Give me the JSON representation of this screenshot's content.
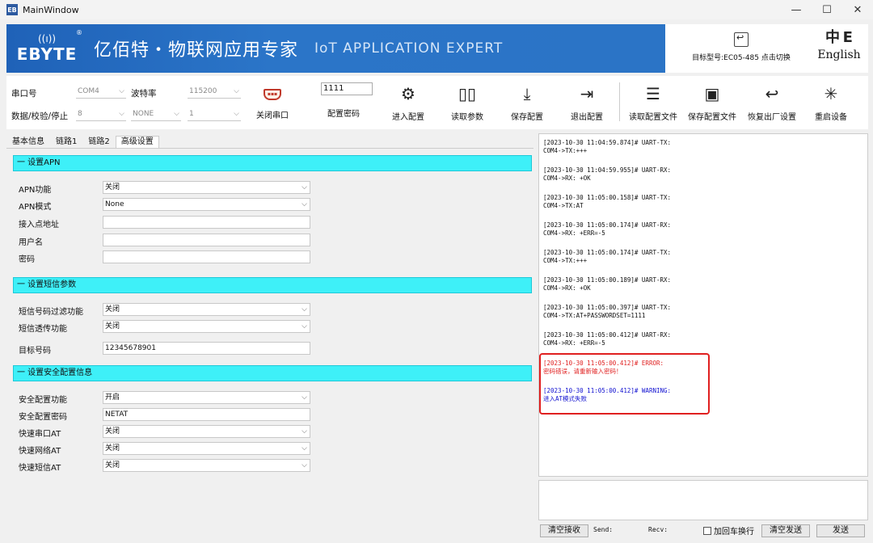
{
  "window": {
    "title": "MainWindow",
    "icon_text": "EB",
    "minimize": "—",
    "maximize": "☐",
    "close": "✕"
  },
  "banner": {
    "logo_signal": "((ı))",
    "logo_text": "EBYTE",
    "logo_reg": "®",
    "title_cn": "亿佰特・物联网应用专家",
    "title_en": "IoT APPLICATION EXPERT",
    "target_model": "目标型号:EC05-485 点击切换",
    "lang_icon": "中 E",
    "lang_label": "English"
  },
  "toolbar": {
    "port_label": "串口号",
    "port_value": "COM4",
    "baud_label": "波特率",
    "baud_value": "115200",
    "dataformat_label": "数据/校验/停止",
    "databits_value": "8",
    "parity_value": "NONE",
    "stopbits_value": "1",
    "close_port_label": "关闭串口",
    "serial_icon_text": "▪▪▪",
    "password_value": "1111",
    "password_label": "配置密码",
    "tools": [
      {
        "icon": "⚙",
        "label": "进入配置"
      },
      {
        "icon": "▯▯",
        "label": "读取参数"
      },
      {
        "icon": "⤓",
        "label": "保存配置"
      },
      {
        "icon": "⇥",
        "label": "退出配置"
      },
      {
        "icon": "☰",
        "label": "读取配置文件"
      },
      {
        "icon": "▣",
        "label": "保存配置文件"
      },
      {
        "icon": "↩",
        "label": "恢复出厂设置"
      },
      {
        "icon": "✳",
        "label": "重启设备"
      }
    ]
  },
  "tabs": [
    "基本信息",
    "链路1",
    "链路2",
    "高级设置"
  ],
  "sections": [
    {
      "title": "一 设置APN",
      "rows": [
        {
          "label": "APN功能",
          "value": "关闭",
          "dropdown": true
        },
        {
          "label": "APN模式",
          "value": "None",
          "dropdown": true
        },
        {
          "label": "接入点地址",
          "value": "",
          "dropdown": false
        },
        {
          "label": "用户名",
          "value": "",
          "dropdown": false
        },
        {
          "label": "密码",
          "value": "",
          "dropdown": false
        }
      ]
    },
    {
      "title": "一 设置短信参数",
      "rows": [
        {
          "label": "短信号码过滤功能",
          "value": "关闭",
          "dropdown": true
        },
        {
          "label": "短信透传功能",
          "value": "关闭",
          "dropdown": true
        },
        {
          "label": "目标号码",
          "value": "12345678901",
          "dropdown": false
        }
      ]
    },
    {
      "title": "一 设置安全配置信息",
      "rows": [
        {
          "label": "安全配置功能",
          "value": "开启",
          "dropdown": true
        },
        {
          "label": "安全配置密码",
          "value": "NETAT",
          "dropdown": false
        },
        {
          "label": "快速串口AT",
          "value": "关闭",
          "dropdown": true
        },
        {
          "label": "快速网络AT",
          "value": "关闭",
          "dropdown": true
        },
        {
          "label": "快速短信AT",
          "value": "关闭",
          "dropdown": true
        }
      ]
    }
  ],
  "log": [
    {
      "line1": "[2023-10-30 11:04:59.874]# UART-TX:",
      "line2": "COM4->TX:+++",
      "level": "normal"
    },
    {
      "line1": "[2023-10-30 11:04:59.955]# UART-RX:",
      "line2": "COM4->RX: +OK",
      "level": "normal"
    },
    {
      "line1": "[2023-10-30 11:05:00.158]# UART-TX:",
      "line2": "COM4->TX:AT",
      "level": "normal"
    },
    {
      "line1": "[2023-10-30 11:05:00.174]# UART-RX:",
      "line2": "COM4->RX: +ERR=-5",
      "level": "normal"
    },
    {
      "line1": "[2023-10-30 11:05:00.174]# UART-TX:",
      "line2": "COM4->TX:+++",
      "level": "normal"
    },
    {
      "line1": "[2023-10-30 11:05:00.189]# UART-RX:",
      "line2": "COM4->RX: +OK",
      "level": "normal"
    },
    {
      "line1": "[2023-10-30 11:05:00.397]# UART-TX:",
      "line2": "COM4->TX:AT+PASSWORDSET=1111",
      "level": "normal"
    },
    {
      "line1": "[2023-10-30 11:05:00.412]# UART-RX:",
      "line2": "COM4->RX: +ERR=-5",
      "level": "normal"
    },
    {
      "line1": "[2023-10-30 11:05:00.412]# ERROR:",
      "line2": "密码错误，请重新输入密码！",
      "level": "error"
    },
    {
      "line1": "[2023-10-30 11:05:00.412]# WARNING:",
      "line2": "进入AT模式失败",
      "level": "warning"
    }
  ],
  "bottom": {
    "clear_recv": "清空接收",
    "send_label": "Send:",
    "recv_label": "Recv:",
    "crlf_label": "加回车换行",
    "clear_send": "清空发送",
    "send_btn": "发送"
  }
}
